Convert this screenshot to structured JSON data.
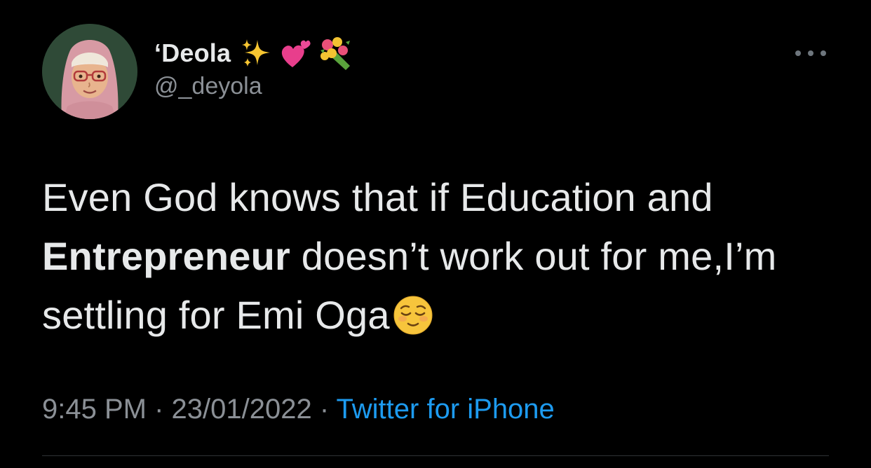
{
  "tweet": {
    "author": {
      "display_name": "‘Deola",
      "handle": "@_deyola",
      "name_emojis": [
        "sparkles-emoji",
        "two-hearts-emoji",
        "bouquet-emoji"
      ],
      "avatar": "bitmoji-avatar"
    },
    "text": {
      "part1": "Even God knows that if Education and ",
      "bold": "Entrepreneur",
      "part2": " doesn’t work out for me,I’m settling for Emi Oga",
      "trailing_emoji": "relieved-face-emoji"
    },
    "time": "9:45 PM",
    "separator": " · ",
    "date": "23/01/2022",
    "source": "Twitter for iPhone"
  },
  "colors": {
    "background": "#000000",
    "text": "#e7e9ea",
    "muted": "#8b9096",
    "link": "#1d9bf0",
    "divider": "#2f3336"
  }
}
